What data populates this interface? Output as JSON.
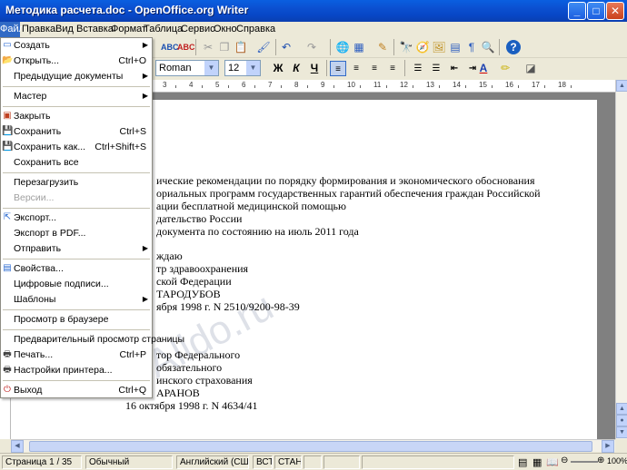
{
  "window": {
    "title": "Методика расчета.doc - OpenOffice.org Writer"
  },
  "menubar": [
    "Файл",
    "Правка",
    "Вид",
    "Вставка",
    "Формат",
    "Таблица",
    "Сервис",
    "Окно",
    "Справка"
  ],
  "file_menu": {
    "items": [
      {
        "label": "Создать",
        "submenu": true
      },
      {
        "label": "Открыть...",
        "shortcut": "Ctrl+O"
      },
      {
        "label": "Предыдущие документы",
        "submenu": true
      },
      {
        "label": "Мастер",
        "submenu": true
      },
      {
        "label": "Закрыть"
      },
      {
        "label": "Сохранить",
        "shortcut": "Ctrl+S"
      },
      {
        "label": "Сохранить как...",
        "shortcut": "Ctrl+Shift+S"
      },
      {
        "label": "Сохранить все"
      },
      {
        "label": "Перезагрузить"
      },
      {
        "label": "Версии...",
        "disabled": true
      },
      {
        "label": "Экспорт..."
      },
      {
        "label": "Экспорт в PDF..."
      },
      {
        "label": "Отправить",
        "submenu": true
      },
      {
        "label": "Свойства..."
      },
      {
        "label": "Цифровые подписи..."
      },
      {
        "label": "Шаблоны",
        "submenu": true
      },
      {
        "label": "Просмотр в браузере"
      },
      {
        "label": "Предварительный просмотр страницы"
      },
      {
        "label": "Печать...",
        "shortcut": "Ctrl+P"
      },
      {
        "label": "Настройки принтера..."
      },
      {
        "label": "Выход",
        "shortcut": "Ctrl+Q"
      }
    ]
  },
  "formatting": {
    "font_name": "Roman",
    "font_size": "12",
    "bold": "Ж",
    "italic": "К",
    "underline": "Ч"
  },
  "ruler_numbers": [
    "3",
    "4",
    "5",
    "6",
    "7",
    "8",
    "9",
    "10",
    "11",
    "12",
    "13",
    "14",
    "15",
    "16",
    "17",
    "18"
  ],
  "document": {
    "lines": [
      "ические рекомендации по порядку формирования и экономического обоснования",
      "ориальных программ государственных гарантий обеспечения граждан Российской",
      "ации бесплатной медицинской помощью",
      "дательство России",
      "документа по состоянию на июль 2011 года",
      "ждаю",
      "тр здравоохранения",
      "ской Федерации",
      "ТАРОДУБОВ",
      "ября 1998 г. N 2510/9200-98-39",
      "тор Федерального",
      "обязательного",
      "инского страхования",
      "АРАНОВ",
      "16 октября 1998 г. N 4634/41"
    ],
    "watermark": "Alldo.ru"
  },
  "statusbar": {
    "page": "Страница  1 / 35",
    "style": "Обычный",
    "language": "Английский (США)",
    "insert": "ВСТ",
    "selection": "СТАНД",
    "zoom": "100%"
  },
  "colors": {
    "titlebar": "#0a5fe0",
    "menu_highlight": "#316ac5"
  }
}
